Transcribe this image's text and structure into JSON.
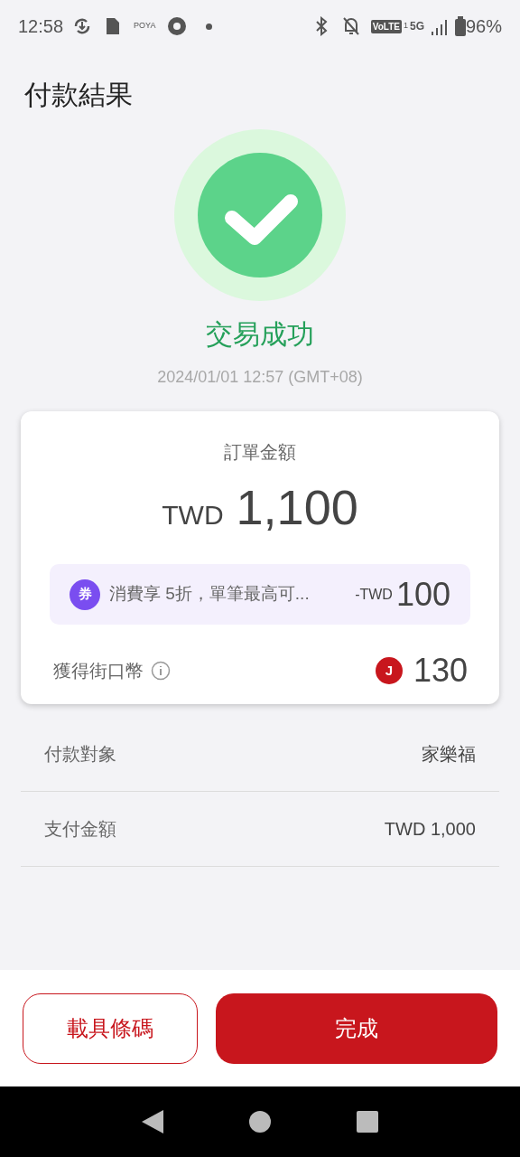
{
  "status_bar": {
    "time": "12:58",
    "app_label": "POYA",
    "volte": "VoLTE",
    "sim": "1",
    "network": "5G",
    "battery": "96%"
  },
  "header": {
    "title": "付款結果"
  },
  "result": {
    "status": "交易成功",
    "timestamp": "2024/01/01 12:57 (GMT+08)"
  },
  "summary_card": {
    "label": "訂單金額",
    "currency": "TWD",
    "amount": "1,100",
    "coupon": {
      "badge": "券",
      "text": "消費享 5折，單筆最高可...",
      "currency": "-TWD",
      "amount": "100"
    },
    "reward": {
      "label": "獲得街口幣",
      "badge": "J",
      "amount": "130"
    }
  },
  "details": [
    {
      "label": "付款對象",
      "value": "家樂福"
    },
    {
      "label": "支付金額",
      "value": "TWD 1,000"
    }
  ],
  "buttons": [
    {
      "label": "載具條碼",
      "kind": "outline"
    },
    {
      "label": "完成",
      "kind": "primary"
    }
  ]
}
